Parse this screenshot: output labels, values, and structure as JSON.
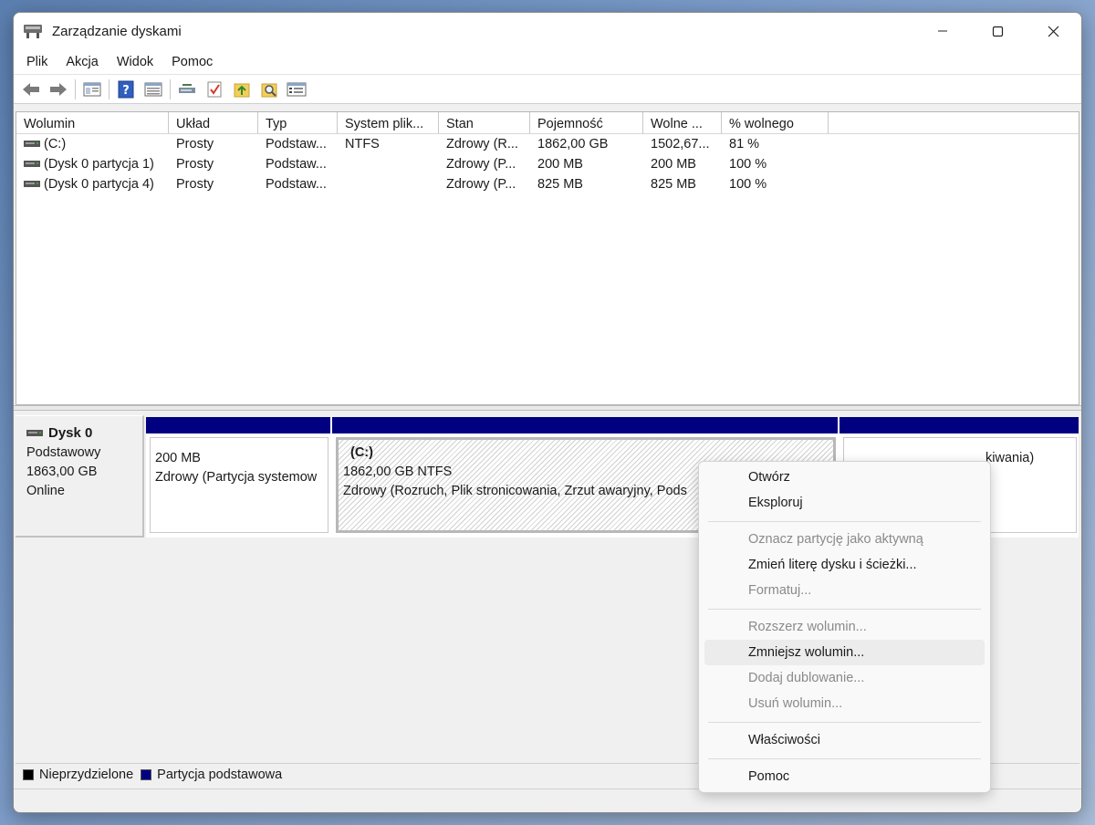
{
  "window": {
    "title": "Zarządzanie dyskami"
  },
  "menu": [
    "Plik",
    "Akcja",
    "Widok",
    "Pomoc"
  ],
  "toolbar": {
    "icons": [
      "back-arrow-icon",
      "forward-arrow-icon",
      "console-tree-icon",
      "help-icon",
      "view-icon",
      "connect-icon",
      "check-icon",
      "folder-up-icon",
      "search-folder-icon",
      "properties-icon"
    ]
  },
  "volume_table": {
    "columns": [
      "Wolumin",
      "Układ",
      "Typ",
      "System plik...",
      "Stan",
      "Pojemność",
      "Wolne ...",
      "% wolnego"
    ],
    "rows": [
      [
        "(C:)",
        "Prosty",
        "Podstaw...",
        "NTFS",
        "Zdrowy (R...",
        "1862,00 GB",
        "1502,67...",
        "81 %"
      ],
      [
        "(Dysk 0 partycja 1)",
        "Prosty",
        "Podstaw...",
        "",
        "Zdrowy (P...",
        "200 MB",
        "200 MB",
        "100 %"
      ],
      [
        "(Dysk 0 partycja 4)",
        "Prosty",
        "Podstaw...",
        "",
        "Zdrowy (P...",
        "825 MB",
        "825 MB",
        "100 %"
      ]
    ]
  },
  "disk": {
    "name": "Dysk 0",
    "type": "Podstawowy",
    "size": "1863,00 GB",
    "status": "Online",
    "partitions": [
      {
        "label": "",
        "size": "200 MB",
        "status": "Zdrowy (Partycja systemow"
      },
      {
        "label": "(C:)",
        "size": "1862,00 GB NTFS",
        "status": "Zdrowy (Rozruch, Plik stronicowania, Zrzut awaryjny, Pods"
      },
      {
        "label": "",
        "size": "",
        "status": "kiwania)"
      }
    ]
  },
  "legend": {
    "unallocated": "Nieprzydzielone",
    "primary": "Partycja podstawowa",
    "unallocated_color": "#000000",
    "primary_color": "#000080"
  },
  "context_menu": {
    "items": [
      {
        "label": "Otwórz",
        "disabled": false
      },
      {
        "label": "Eksploruj",
        "disabled": false
      },
      {
        "label": "Oznacz partycję jako aktywną",
        "disabled": true
      },
      {
        "label": "Zmień literę dysku i ścieżki...",
        "disabled": false
      },
      {
        "label": "Formatuj...",
        "disabled": true
      },
      {
        "label": "Rozszerz wolumin...",
        "disabled": true
      },
      {
        "label": "Zmniejsz wolumin...",
        "disabled": false,
        "highlighted": true
      },
      {
        "label": "Dodaj dublowanie...",
        "disabled": true
      },
      {
        "label": "Usuń wolumin...",
        "disabled": true
      },
      {
        "label": "Właściwości",
        "disabled": false
      },
      {
        "label": "Pomoc",
        "disabled": false
      }
    ]
  }
}
